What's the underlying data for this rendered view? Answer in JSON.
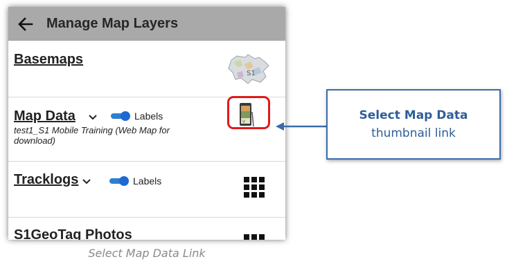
{
  "appbar": {
    "title": "Manage Map Layers",
    "back_icon": "back-arrow-icon"
  },
  "rows": [
    {
      "title": "Basemaps",
      "thumbnail": "basemap-thumbnail"
    },
    {
      "title": "Map Data",
      "labels_toggle": {
        "label": "Labels",
        "on": true
      },
      "subtitle": "test1_S1 Mobile Training (Web Map for download)",
      "thumbnail": "map-data-thumbnail"
    },
    {
      "title": "Tracklogs",
      "labels_toggle": {
        "label": "Labels",
        "on": true
      },
      "icon": "grid-icon"
    },
    {
      "title": "S1GeoTag Photos",
      "icon": "grid-icon"
    }
  ],
  "callout": {
    "line1": "Select Map Data",
    "line2": "thumbnail link"
  },
  "caption": "Select Map Data Link",
  "colors": {
    "appbar": "#a9a9a9",
    "toggle": "#1d6ad2",
    "highlight_box": "#e0191a",
    "callout_border": "#3b6ba8",
    "callout_text": "#2e5d99"
  }
}
